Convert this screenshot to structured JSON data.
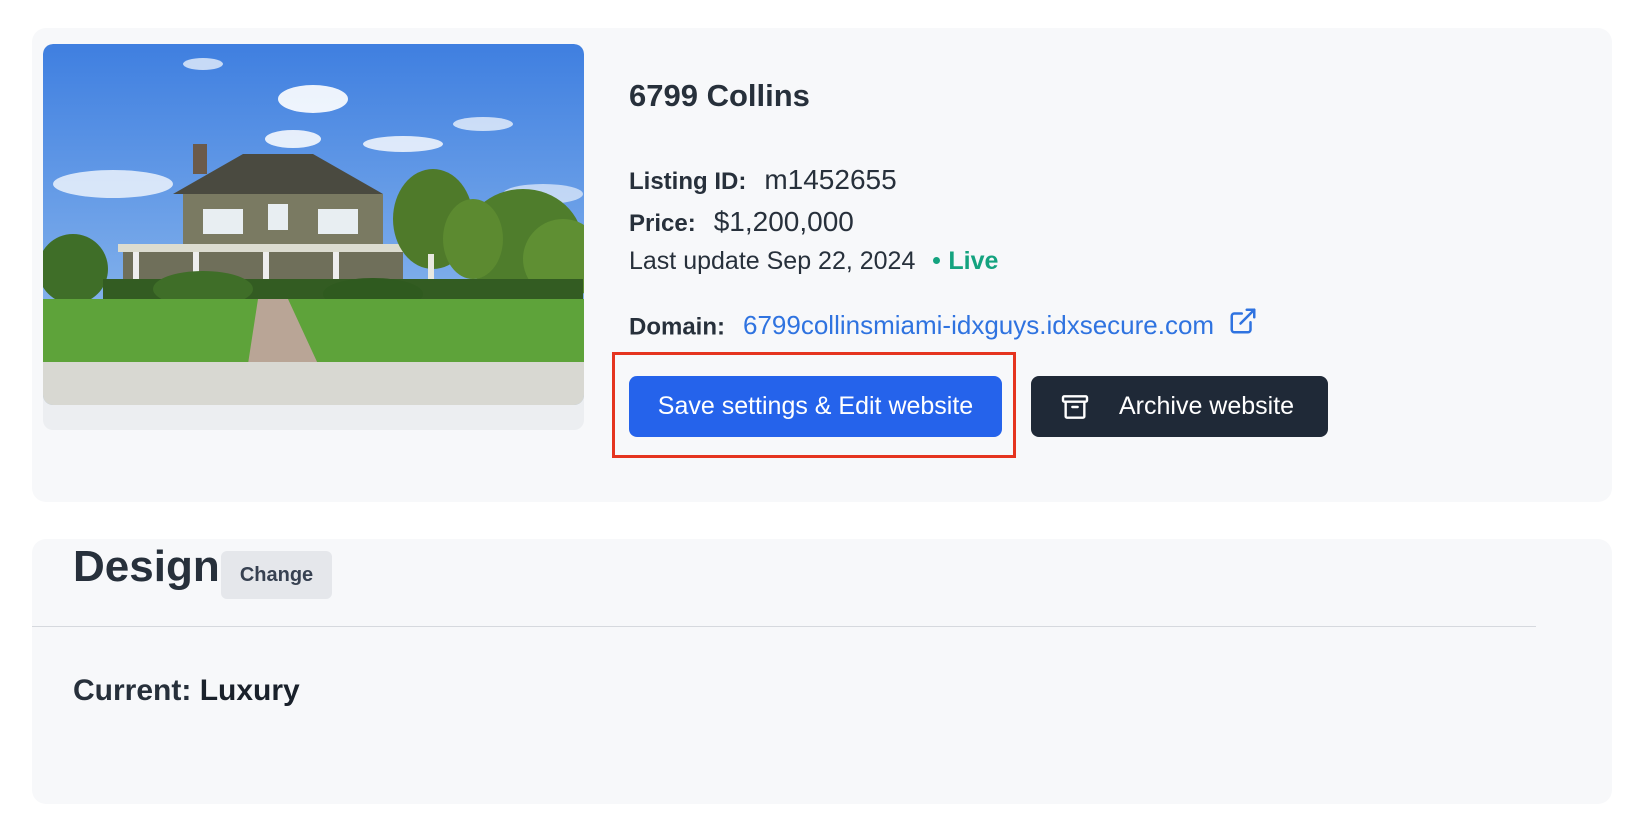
{
  "listing": {
    "title": "6799 Collins",
    "listing_id_label": "Listing ID:",
    "listing_id": "m1452655",
    "price_label": "Price:",
    "price": "$1,200,000",
    "last_update": "Last update Sep 22, 2024",
    "status": "Live",
    "domain_label": "Domain:",
    "domain": "6799collinsmiami-idxguys.idxsecure.com",
    "save_button": "Save settings & Edit website",
    "archive_button": "Archive website"
  },
  "design": {
    "title": "Design",
    "change_button": "Change",
    "current_label": "Current:",
    "current_value": "Luxury"
  },
  "colors": {
    "primary": "#2563eb",
    "dark": "#1f2937",
    "live": "#14a37f",
    "link": "#2f73e0",
    "highlight": "#e5341f"
  },
  "icons": {
    "external_link": "external-link-icon",
    "archive": "archive-box-icon"
  }
}
